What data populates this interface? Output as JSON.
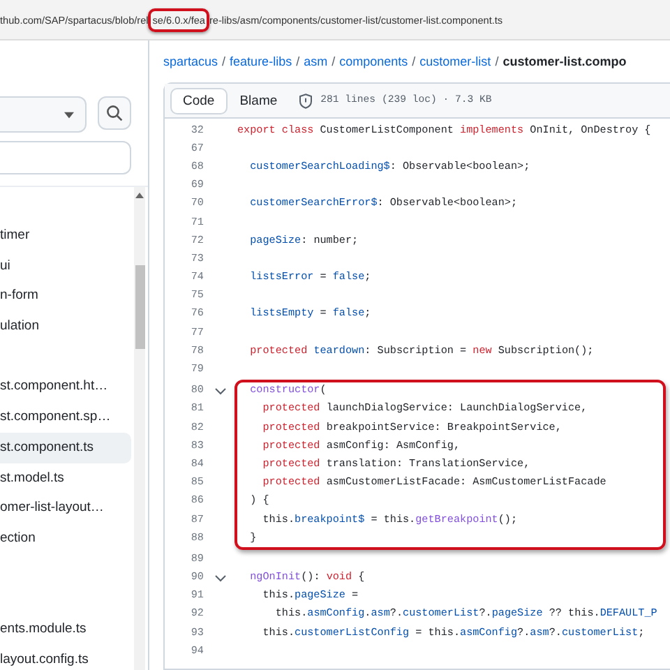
{
  "address_bar": {
    "segments": [
      {
        "text": "thub.com/SAP/spartacus/blob/rel",
        "highlighted": false
      },
      {
        "text": "se/6.0.x/fea",
        "highlighted": true
      },
      {
        "text": "re-libs/asm/components/customer-list/customer-list.component.ts",
        "highlighted": false
      }
    ]
  },
  "sidebar": {
    "items": [
      {
        "kind": "file",
        "label": "timer",
        "selected": false
      },
      {
        "kind": "file",
        "label": "ui",
        "selected": false
      },
      {
        "kind": "file",
        "label": "n-form",
        "selected": false
      },
      {
        "kind": "file",
        "label": "ulation",
        "selected": false
      },
      {
        "kind": "blank",
        "selected": false
      },
      {
        "kind": "file",
        "label": "st.component.ht…",
        "selected": false
      },
      {
        "kind": "file",
        "label": "st.component.sp…",
        "selected": false
      },
      {
        "kind": "file",
        "label": "st.component.ts",
        "selected": true
      },
      {
        "kind": "file",
        "label": "st.model.ts",
        "selected": false
      },
      {
        "kind": "file",
        "label": "omer-list-layout…",
        "selected": false
      },
      {
        "kind": "file",
        "label": "ection",
        "selected": false
      },
      {
        "kind": "blank",
        "selected": false
      },
      {
        "kind": "blank",
        "selected": false
      },
      {
        "kind": "file",
        "label": "ents.module.ts",
        "selected": false
      },
      {
        "kind": "file",
        "label": "layout.config.ts",
        "selected": false
      }
    ]
  },
  "breadcrumb": {
    "separator": "/",
    "items": [
      {
        "text": "spartacus",
        "current": false
      },
      {
        "text": "feature-libs",
        "current": false
      },
      {
        "text": "asm",
        "current": false
      },
      {
        "text": "components",
        "current": false
      },
      {
        "text": "customer-list",
        "current": false
      },
      {
        "text": "customer-list.compo",
        "current": true
      }
    ]
  },
  "file_header": {
    "tabs": [
      {
        "label": "Code",
        "selected": true
      },
      {
        "label": "Blame",
        "selected": false
      }
    ],
    "info": "281 lines (239 loc) · 7.3 KB"
  },
  "code": {
    "blocks": [
      {
        "highlighted": false,
        "lines": [
          {
            "num": "32",
            "fold": false,
            "tokens": [
              {
                "kind": "kw",
                "t": "export class "
              },
              {
                "kind": "pl",
                "t": "CustomerListComponent "
              },
              {
                "kind": "kw",
                "t": "implements "
              },
              {
                "kind": "pl",
                "t": "OnInit, OnDestroy {"
              }
            ]
          },
          {
            "num": "67",
            "fold": false
          },
          {
            "num": "68",
            "fold": false,
            "tokens": [
              {
                "kind": "pr",
                "t": "  customerSearchLoading$"
              },
              {
                "kind": "pl",
                "t": ": Observable<boolean>;"
              }
            ]
          },
          {
            "num": "69",
            "fold": false
          },
          {
            "num": "70",
            "fold": false,
            "tokens": [
              {
                "kind": "pr",
                "t": "  customerSearchError$"
              },
              {
                "kind": "pl",
                "t": ": Observable<boolean>;"
              }
            ]
          },
          {
            "num": "71",
            "fold": false
          },
          {
            "num": "72",
            "fold": false,
            "tokens": [
              {
                "kind": "pr",
                "t": "  pageSize"
              },
              {
                "kind": "pl",
                "t": ": number;"
              }
            ]
          },
          {
            "num": "73",
            "fold": false
          },
          {
            "num": "74",
            "fold": false,
            "tokens": [
              {
                "kind": "pr",
                "t": "  listsError"
              },
              {
                "kind": "pl",
                "t": " = "
              },
              {
                "kind": "pr",
                "t": "false"
              },
              {
                "kind": "pl",
                "t": ";"
              }
            ]
          },
          {
            "num": "75",
            "fold": false
          },
          {
            "num": "76",
            "fold": false,
            "tokens": [
              {
                "kind": "pr",
                "t": "  listsEmpty"
              },
              {
                "kind": "pl",
                "t": " = "
              },
              {
                "kind": "pr",
                "t": "false"
              },
              {
                "kind": "pl",
                "t": ";"
              }
            ]
          },
          {
            "num": "77",
            "fold": false
          },
          {
            "num": "78",
            "fold": false,
            "tokens": [
              {
                "kind": "kw",
                "t": "  protected "
              },
              {
                "kind": "pr",
                "t": "teardown"
              },
              {
                "kind": "pl",
                "t": ": Subscription = "
              },
              {
                "kind": "kw",
                "t": "new "
              },
              {
                "kind": "pl",
                "t": "Subscription();"
              }
            ]
          },
          {
            "num": "79",
            "fold": false
          }
        ]
      },
      {
        "highlighted": true,
        "lines": [
          {
            "num": "80",
            "fold": true,
            "tokens": [
              {
                "kind": "fn",
                "t": "  constructor"
              },
              {
                "kind": "pl",
                "t": "("
              }
            ]
          },
          {
            "num": "81",
            "fold": false,
            "tokens": [
              {
                "kind": "kw",
                "t": "    protected "
              },
              {
                "kind": "pl",
                "t": "launchDialogService: LaunchDialogService,"
              }
            ]
          },
          {
            "num": "82",
            "fold": false,
            "tokens": [
              {
                "kind": "kw",
                "t": "    protected "
              },
              {
                "kind": "pl",
                "t": "breakpointService: BreakpointService,"
              }
            ]
          },
          {
            "num": "83",
            "fold": false,
            "tokens": [
              {
                "kind": "kw",
                "t": "    protected "
              },
              {
                "kind": "pl",
                "t": "asmConfig: AsmConfig,"
              }
            ]
          },
          {
            "num": "84",
            "fold": false,
            "tokens": [
              {
                "kind": "kw",
                "t": "    protected "
              },
              {
                "kind": "pl",
                "t": "translation: TranslationService,"
              }
            ]
          },
          {
            "num": "85",
            "fold": false,
            "tokens": [
              {
                "kind": "kw",
                "t": "    protected "
              },
              {
                "kind": "pl",
                "t": "asmCustomerListFacade: AsmCustomerListFacade"
              }
            ]
          },
          {
            "num": "86",
            "fold": false,
            "tokens": [
              {
                "kind": "pl",
                "t": "  ) {"
              }
            ]
          },
          {
            "num": "87",
            "fold": false,
            "tokens": [
              {
                "kind": "pl",
                "t": "    this."
              },
              {
                "kind": "pr",
                "t": "breakpoint$"
              },
              {
                "kind": "pl",
                "t": " = this."
              },
              {
                "kind": "fn",
                "t": "getBreakpoint"
              },
              {
                "kind": "pl",
                "t": "();"
              }
            ]
          },
          {
            "num": "88",
            "fold": false,
            "tokens": [
              {
                "kind": "pl",
                "t": "  }"
              }
            ]
          }
        ]
      },
      {
        "highlighted": false,
        "lines": [
          {
            "num": "89",
            "fold": false
          },
          {
            "num": "90",
            "fold": true,
            "tokens": [
              {
                "kind": "fn",
                "t": "  ngOnInit"
              },
              {
                "kind": "pl",
                "t": "(): "
              },
              {
                "kind": "kw",
                "t": "void "
              },
              {
                "kind": "pl",
                "t": "{"
              }
            ]
          },
          {
            "num": "91",
            "fold": false,
            "tokens": [
              {
                "kind": "pl",
                "t": "    this."
              },
              {
                "kind": "pr",
                "t": "pageSize"
              },
              {
                "kind": "pl",
                "t": " ="
              }
            ]
          },
          {
            "num": "92",
            "fold": false,
            "tokens": [
              {
                "kind": "pl",
                "t": "      this."
              },
              {
                "kind": "pr",
                "t": "asmConfig"
              },
              {
                "kind": "pl",
                "t": "."
              },
              {
                "kind": "pr",
                "t": "asm"
              },
              {
                "kind": "pl",
                "t": "?."
              },
              {
                "kind": "pr",
                "t": "customerList"
              },
              {
                "kind": "pl",
                "t": "?."
              },
              {
                "kind": "pr",
                "t": "pageSize"
              },
              {
                "kind": "pl",
                "t": " ?? this."
              },
              {
                "kind": "pr",
                "t": "DEFAULT_P"
              }
            ]
          },
          {
            "num": "93",
            "fold": false,
            "tokens": [
              {
                "kind": "pl",
                "t": "    this."
              },
              {
                "kind": "pr",
                "t": "customerListConfig"
              },
              {
                "kind": "pl",
                "t": " = this."
              },
              {
                "kind": "pr",
                "t": "asmConfig"
              },
              {
                "kind": "pl",
                "t": "?."
              },
              {
                "kind": "pr",
                "t": "asm"
              },
              {
                "kind": "pl",
                "t": "?."
              },
              {
                "kind": "pr",
                "t": "customerList"
              },
              {
                "kind": "pl",
                "t": ";"
              }
            ]
          },
          {
            "num": "94",
            "fold": false
          }
        ]
      }
    ]
  }
}
